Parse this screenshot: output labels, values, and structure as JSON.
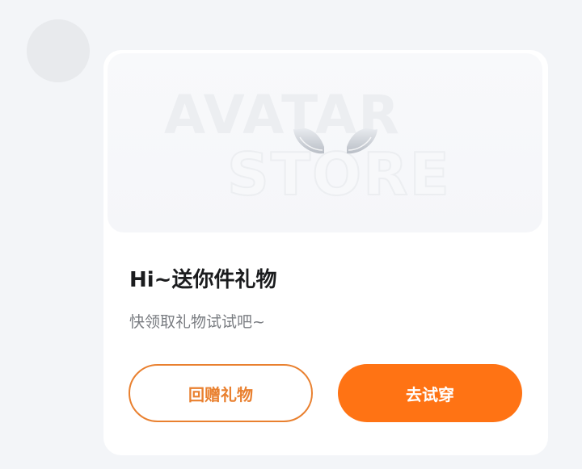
{
  "card": {
    "banner": {
      "watermark_line1": "AVATAR",
      "watermark_line2": "STORE",
      "art_icon": "wings-icon"
    },
    "title": "Hi~送你件礼物",
    "subtitle": "快领取礼物试试吧~",
    "buttons": {
      "return_gift_label": "回赠礼物",
      "try_on_label": "去试穿"
    }
  },
  "colors": {
    "accent": "#ff7314",
    "outline": "#e9802f",
    "title": "#1b1c1e",
    "subtitle": "#7a7d82",
    "background": "#f3f5f8"
  }
}
